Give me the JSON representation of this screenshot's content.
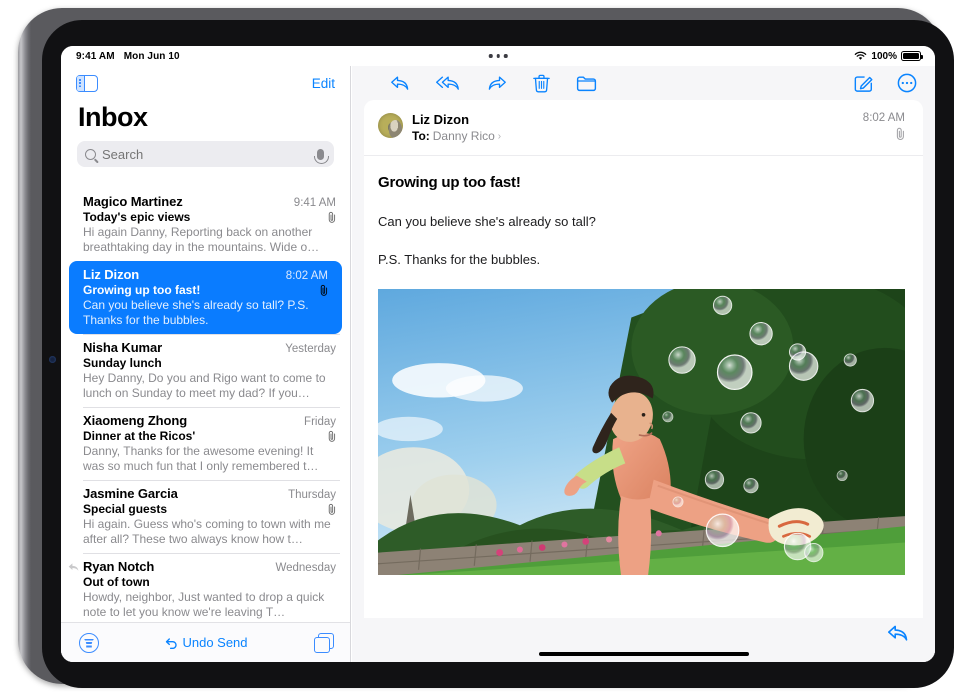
{
  "status_bar": {
    "time": "9:41 AM",
    "date": "Mon Jun 10",
    "battery_percent": "100%",
    "wifi_icon": "wifi-icon",
    "battery_icon": "battery-icon",
    "multitask_icon": "multitasking-dots-icon"
  },
  "sidebar": {
    "toggle_icon": "sidebar-toggle-icon",
    "edit_label": "Edit",
    "title": "Inbox",
    "search": {
      "placeholder": "Search",
      "value": "",
      "search_icon": "search-icon",
      "mic_icon": "microphone-icon"
    },
    "messages": [
      {
        "sender": "Magico Martinez",
        "date": "9:41 AM",
        "subject": "Today's epic views",
        "preview": "Hi again Danny, Reporting back on another breathtaking day in the mountains. Wide o…",
        "has_attachment": true,
        "replied": false,
        "selected": false
      },
      {
        "sender": "Liz Dizon",
        "date": "8:02 AM",
        "subject": "Growing up too fast!",
        "preview": "Can you believe she's already so tall? P.S. Thanks for the bubbles.",
        "has_attachment": true,
        "replied": false,
        "selected": true
      },
      {
        "sender": "Nisha Kumar",
        "date": "Yesterday",
        "subject": "Sunday lunch",
        "preview": "Hey Danny, Do you and Rigo want to come to lunch on Sunday to meet my dad? If you…",
        "has_attachment": false,
        "replied": false,
        "selected": false
      },
      {
        "sender": "Xiaomeng Zhong",
        "date": "Friday",
        "subject": "Dinner at the Ricos'",
        "preview": "Danny, Thanks for the awesome evening! It was so much fun that I only remembered t…",
        "has_attachment": true,
        "replied": false,
        "selected": false
      },
      {
        "sender": "Jasmine Garcia",
        "date": "Thursday",
        "subject": "Special guests",
        "preview": "Hi again. Guess who's coming to town with me after all? These two always know how t…",
        "has_attachment": true,
        "replied": false,
        "selected": false
      },
      {
        "sender": "Ryan Notch",
        "date": "Wednesday",
        "subject": "Out of town",
        "preview": "Howdy, neighbor, Just wanted to drop a quick note to let you know we're leaving T…",
        "has_attachment": false,
        "replied": true,
        "selected": false
      }
    ],
    "bottom_bar": {
      "filter_icon": "filter-icon",
      "undo_send_label": "Undo Send",
      "undo_icon": "undo-arrow-icon",
      "compose_icon": "new-message-stack-icon"
    }
  },
  "detail": {
    "toolbar": [
      {
        "name": "reply-button",
        "icon": "reply-icon"
      },
      {
        "name": "reply-all-button",
        "icon": "reply-all-icon"
      },
      {
        "name": "forward-button",
        "icon": "forward-icon"
      },
      {
        "name": "delete-button",
        "icon": "trash-icon"
      },
      {
        "name": "move-to-folder-button",
        "icon": "folder-icon"
      },
      {
        "name": "compose-button",
        "icon": "compose-pencil-icon"
      },
      {
        "name": "more-options-button",
        "icon": "ellipsis-circle-icon"
      }
    ],
    "message": {
      "sender": "Liz Dizon",
      "to_label": "To:",
      "recipient": "Danny Rico",
      "chevron": "›",
      "time": "8:02 AM",
      "attachment_icon": "paperclip-icon",
      "subject": "Growing up too fast!",
      "paragraphs": [
        "Can you believe she's already so tall?",
        "P.S. Thanks for the bubbles."
      ],
      "photo_alt": "Girl in peach overalls kicking in the air surrounded by soap bubbles in a sunny garden"
    },
    "bottom": {
      "reply_icon": "reply-icon"
    }
  },
  "colors": {
    "accent_blue": "#0a84ff",
    "selected_row_blue": "#0a7cff",
    "sidebar_bg": "#ffffff",
    "detail_bg": "#f6f6f8",
    "secondary_text": "#8a8a8e"
  }
}
